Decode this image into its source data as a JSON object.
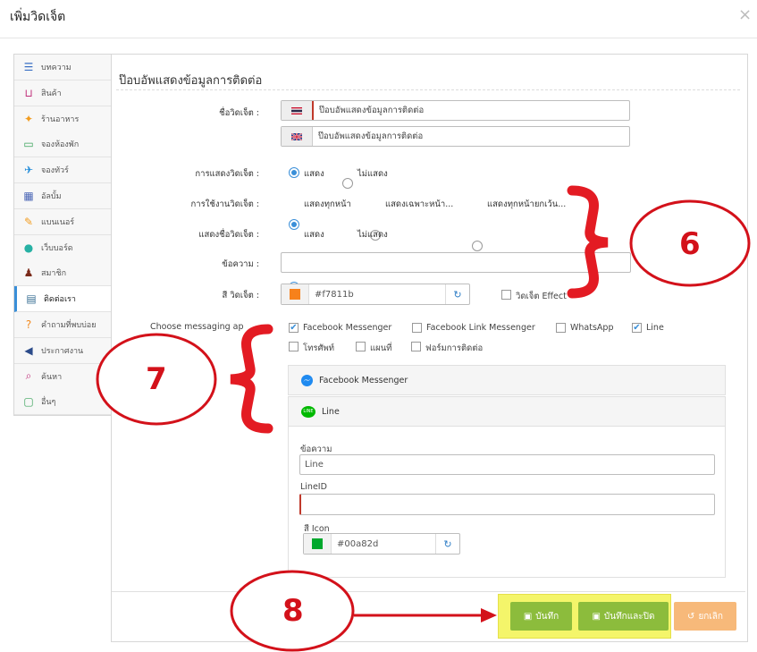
{
  "modal": {
    "title": "เพิ่มวิดเจ็ต",
    "close": "×"
  },
  "sidebar": {
    "items": [
      {
        "label": "บทความ",
        "icon": "article-icon",
        "color": "#3a6fc4"
      },
      {
        "label": "สินค้า",
        "icon": "basket-icon",
        "color": "#c0307a"
      },
      {
        "label": "ร้านอาหาร",
        "icon": "restaurant-icon",
        "color": "#f29c1f"
      },
      {
        "label": "จองห้องพัก",
        "icon": "bed-icon",
        "color": "#3aa35a"
      },
      {
        "label": "จองทัวร์",
        "icon": "plane-icon",
        "color": "#1e8ad8"
      },
      {
        "label": "อัลบั้ม",
        "icon": "album-icon",
        "color": "#4c67b6"
      },
      {
        "label": "แบนเนอร์",
        "icon": "banner-icon",
        "color": "#f29c1f"
      },
      {
        "label": "เว็บบอร์ด",
        "icon": "chat-icon",
        "color": "#27b1a4"
      },
      {
        "label": "สมาชิก",
        "icon": "member-icon",
        "color": "#7a2a1a"
      },
      {
        "label": "ติดต่อเรา",
        "icon": "contact-icon",
        "color": "#3a6f94",
        "active": true
      },
      {
        "label": "คำถามที่พบบ่อย",
        "icon": "faq-icon",
        "color": "#f28a1f"
      },
      {
        "label": "ประกาศงาน",
        "icon": "megaphone-icon",
        "color": "#2c4b8a"
      },
      {
        "label": "ค้นหา",
        "icon": "search-icon",
        "color": "#c0307a"
      },
      {
        "label": "อื่นๆ",
        "icon": "box-icon",
        "color": "#3aa35a"
      }
    ]
  },
  "form": {
    "section_title": "ป๊อบอัพแสดงข้อมูลการติดต่อ",
    "widget_name_label": "ชื่อวิดเจ็ต :",
    "widget_name_th": "ป๊อบอัพแสดงข้อมูลการติดต่อ",
    "widget_name_en": "ป๊อบอัพแสดงข้อมูลการติดต่อ",
    "display_label": "การแสดงวิดเจ็ต :",
    "display_options": [
      "แสดง",
      "ไม่แสดง"
    ],
    "usage_label": "การใช้งานวิดเจ็ต :",
    "usage_options": [
      "แสดงทุกหน้า",
      "แสดงเฉพาะหน้า...",
      "แสดงทุกหน้ายกเว้น..."
    ],
    "show_name_label": "แสดงชื่อวิดเจ็ต :",
    "show_name_options": [
      "แสดง",
      "ไม่แสดง"
    ],
    "message_label": "ข้อความ :",
    "message_value": "",
    "color_label": "สี วิดเจ็ต :",
    "color_value": "#f7811b",
    "effect_label": "วิดเจ็ต Effect",
    "apps_label": "Choose messaging ap",
    "apps": [
      {
        "label": "Facebook Messenger",
        "checked": true
      },
      {
        "label": "Facebook Link Messenger",
        "checked": false
      },
      {
        "label": "WhatsApp",
        "checked": false
      },
      {
        "label": "Line",
        "checked": true
      },
      {
        "label": "โทรศัพท์",
        "checked": false
      },
      {
        "label": "แผนที่",
        "checked": false
      },
      {
        "label": "ฟอร์มการติดต่อ",
        "checked": false
      }
    ],
    "fb_panel_title": "Facebook Messenger",
    "line_panel_title": "Line",
    "line_badge": "LINE",
    "line_message_label": "ข้อความ",
    "line_message_value": "Line",
    "line_id_label": "LineID",
    "line_id_value": "",
    "line_icon_color_label": "สี Icon",
    "line_icon_color_value": "#00a82d"
  },
  "colors": {
    "widget": "#f7811b",
    "line_icon": "#00a82d",
    "accent": "#3a8fd8",
    "annotation": "#d3111a"
  },
  "footer": {
    "save": "บันทึก",
    "save_close": "บันทึกและปิด",
    "cancel": "ยกเลิก"
  },
  "annotations": {
    "n6": "6",
    "n7": "7",
    "n8": "8"
  }
}
